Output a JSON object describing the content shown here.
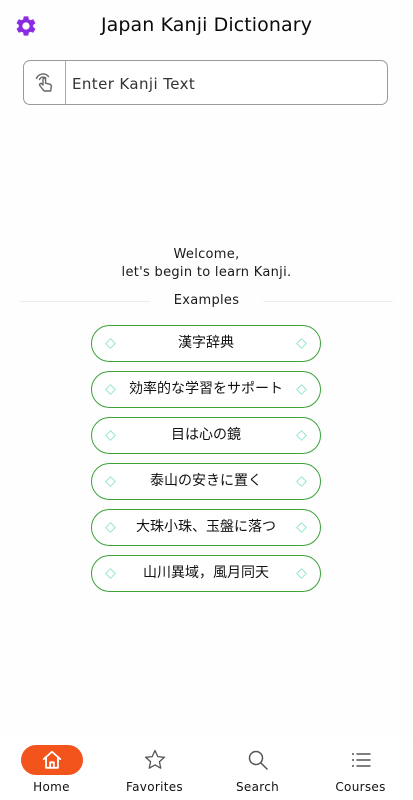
{
  "header": {
    "title": "Japan Kanji Dictionary",
    "settings_icon": "gear-icon"
  },
  "search": {
    "placeholder": "Enter Kanji Text",
    "value": "",
    "icon": "hand-tap-icon"
  },
  "welcome": {
    "line1": "Welcome,",
    "line2": "let's begin to learn Kanji."
  },
  "examples": {
    "label": "Examples",
    "items": [
      "漢字辞典",
      "効率的な学習をサポート",
      "目は心の鏡",
      "泰山の安きに置く",
      "大珠小珠、玉盤に落つ",
      "山川異域，風月同天"
    ]
  },
  "tabs": [
    {
      "label": "Home",
      "icon": "home-icon",
      "active": true
    },
    {
      "label": "Favorites",
      "icon": "star-icon",
      "active": false
    },
    {
      "label": "Search",
      "icon": "search-icon",
      "active": false
    },
    {
      "label": "Courses",
      "icon": "list-icon",
      "active": false
    }
  ],
  "colors": {
    "accent": "#f2541b",
    "gear": "#8a2be2",
    "example_border": "#3aa33a",
    "diamond": "#8fe3d3"
  }
}
